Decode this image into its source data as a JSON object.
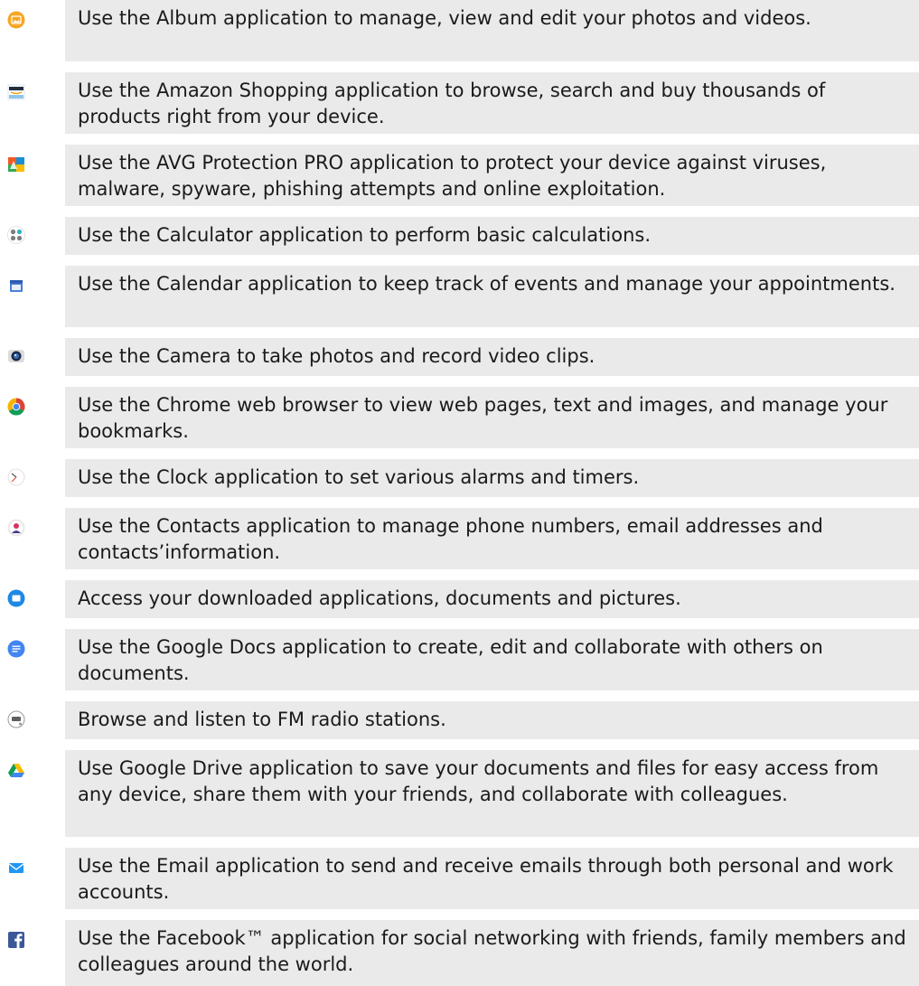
{
  "apps": [
    {
      "icon": "album-icon",
      "description": "Use the Album application to manage, view and edit your photos and videos."
    },
    {
      "icon": "amazon-shopping-icon",
      "description": "Use the Amazon Shopping application to browse, search and buy thousands of products right from your device."
    },
    {
      "icon": "avg-protection-icon",
      "description": "Use the AVG Protection PRO application to protect your device against viruses, malware, spyware, phishing attempts and online exploitation."
    },
    {
      "icon": "calculator-icon",
      "description": "Use the Calculator application to perform basic calculations."
    },
    {
      "icon": "calendar-icon",
      "description": "Use the Calendar application to keep track of events and manage your appointments."
    },
    {
      "icon": "camera-icon",
      "description": "Use the Camera to take photos and record video clips."
    },
    {
      "icon": "chrome-icon",
      "description": "Use the Chrome web browser to view web pages, text and images, and manage your bookmarks."
    },
    {
      "icon": "clock-icon",
      "description": "Use the Clock application to set various alarms and timers."
    },
    {
      "icon": "contacts-icon",
      "description": "Use the Contacts application to manage phone numbers, email addresses and contacts’information."
    },
    {
      "icon": "downloads-folder-icon",
      "description": "Access your downloaded applications, documents and pictures."
    },
    {
      "icon": "google-docs-icon",
      "description": "Use the Google Docs application to create, edit and collaborate with others on documents."
    },
    {
      "icon": "fm-radio-icon",
      "description": "Browse and listen to FM radio stations."
    },
    {
      "icon": "google-drive-icon",
      "description": "Use Google Drive application to save your documents and files for easy access from any device, share them with your friends, and collaborate with colleagues."
    },
    {
      "icon": "email-icon",
      "description": "Use the Email application to send and receive emails through both personal and work accounts."
    },
    {
      "icon": "facebook-icon",
      "description": "Use the Facebook™ application for social networking with friends, family members and colleagues around the world."
    }
  ]
}
